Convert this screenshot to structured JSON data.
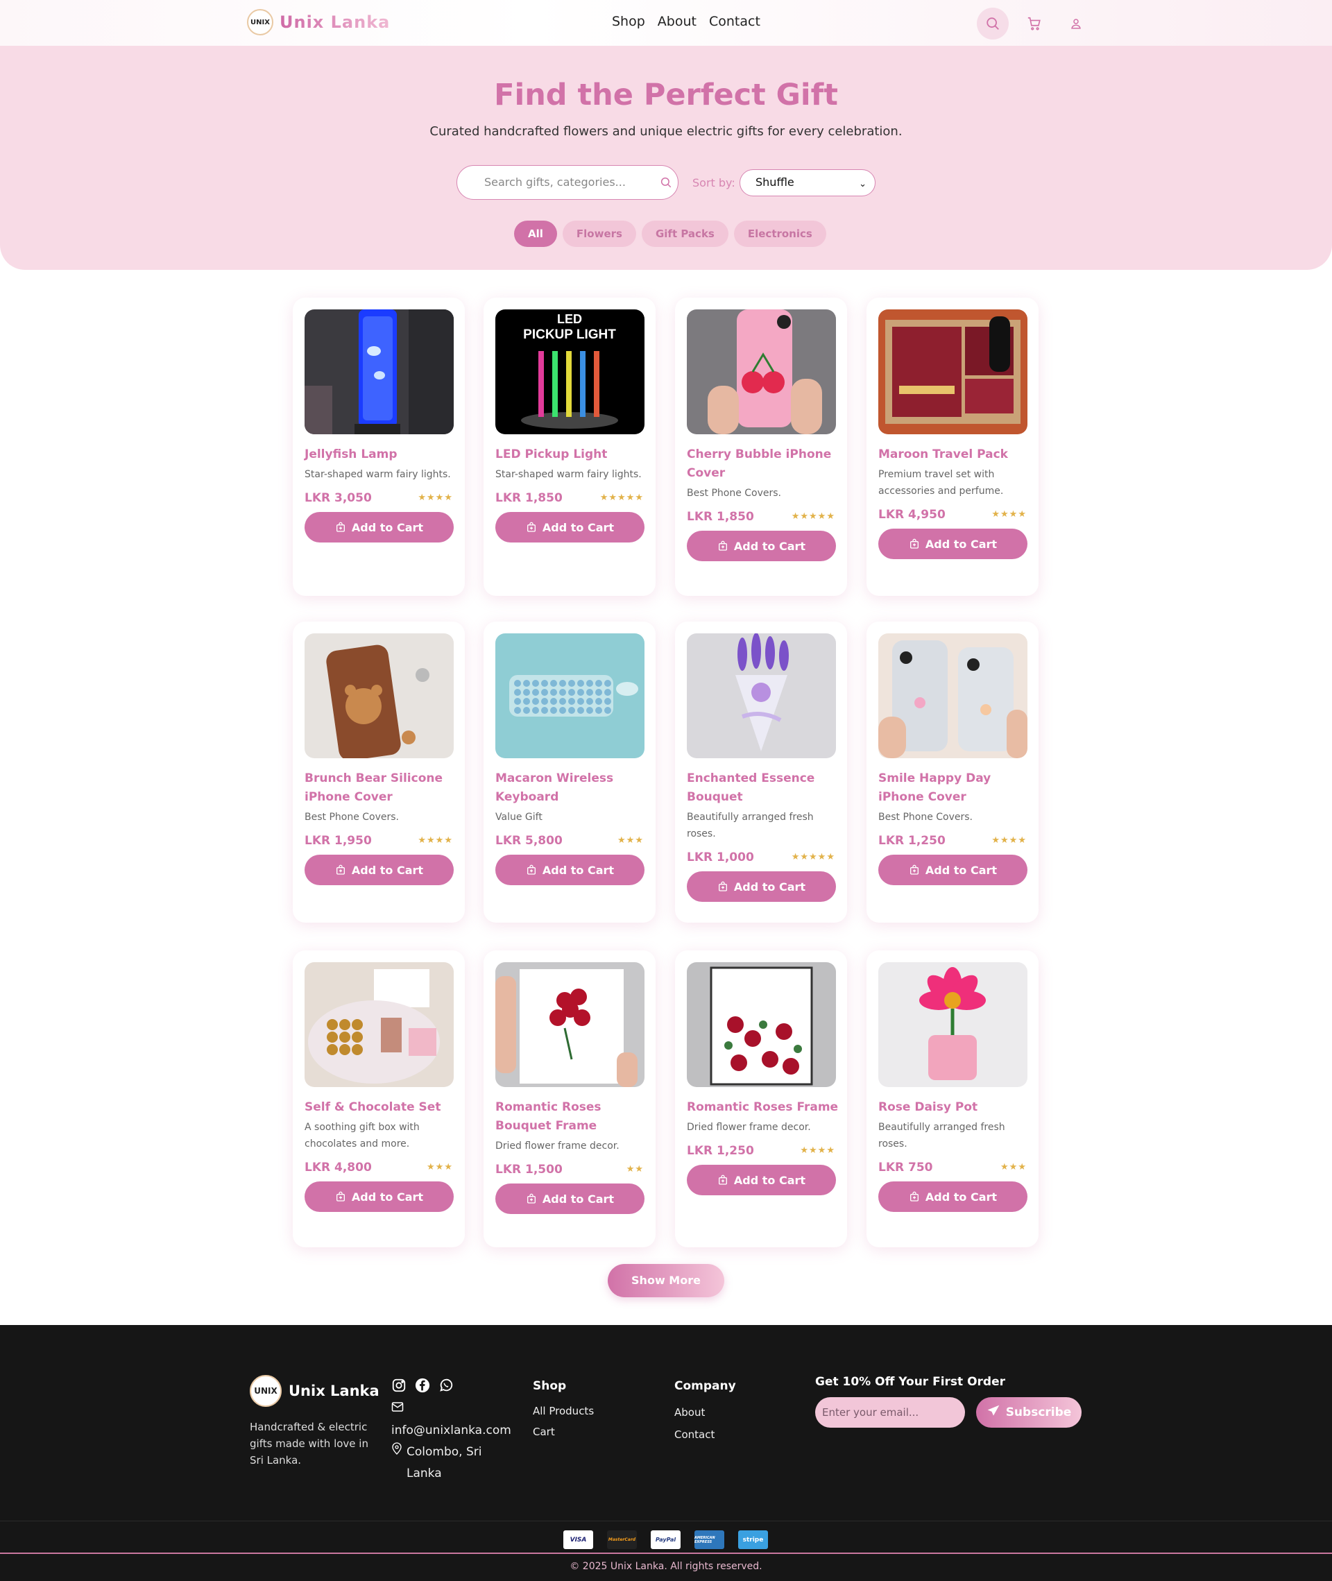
{
  "nav": {
    "logo_text": "UNIX",
    "brand": "Unix Lanka",
    "links": [
      "Shop",
      "About",
      "Contact"
    ],
    "icons": [
      "search-icon",
      "cart-icon",
      "user-icon"
    ]
  },
  "hero": {
    "title": "Find the Perfect Gift",
    "subtitle": "Curated handcrafted flowers and unique electric gifts for every celebration.",
    "search_placeholder": "Search gifts, categories...",
    "sort_label": "Sort by:",
    "sort_value": "Shuffle",
    "filters": [
      {
        "label": "All",
        "active": true
      },
      {
        "label": "Flowers",
        "active": false
      },
      {
        "label": "Gift Packs",
        "active": false
      },
      {
        "label": "Electronics",
        "active": false
      }
    ]
  },
  "products": [
    {
      "name": "Jellyfish Lamp",
      "desc": "Star-shaped warm fairy lights.",
      "price": "LKR 3,050",
      "stars": 4,
      "button": "Add to Cart"
    },
    {
      "name": "LED Pickup Light",
      "desc": "Star-shaped warm fairy lights.",
      "price": "LKR 1,850",
      "stars": 5,
      "button": "Add to Cart",
      "image_text": [
        "LED",
        "PICKUP LIGHT"
      ]
    },
    {
      "name": "Cherry Bubble iPhone Cover",
      "desc": "Best Phone Covers.",
      "price": "LKR 1,850",
      "stars": 5,
      "button": "Add to Cart"
    },
    {
      "name": "Maroon Travel Pack",
      "desc": "Premium travel set with accessories and perfume.",
      "price": "LKR 4,950",
      "stars": 4,
      "button": "Add to Cart"
    },
    {
      "name": "Brunch Bear Silicone iPhone Cover",
      "desc": "Best Phone Covers.",
      "price": "LKR 1,950",
      "stars": 4,
      "button": "Add to Cart"
    },
    {
      "name": "Macaron Wireless Keyboard",
      "desc": "Value Gift",
      "price": "LKR 5,800",
      "stars": 3,
      "button": "Add to Cart"
    },
    {
      "name": "Enchanted Essence Bouquet",
      "desc": "Beautifully arranged fresh roses.",
      "price": "LKR 1,000",
      "stars": 5,
      "button": "Add to Cart"
    },
    {
      "name": "Smile Happy Day iPhone Cover",
      "desc": "Best Phone Covers.",
      "price": "LKR 1,250",
      "stars": 4,
      "button": "Add to Cart"
    },
    {
      "name": "Self & Chocolate Set",
      "desc": "A soothing gift box with chocolates and more.",
      "price": "LKR 4,800",
      "stars": 3,
      "button": "Add to Cart"
    },
    {
      "name": "Romantic Roses Bouquet Frame",
      "desc": "Dried flower frame decor.",
      "price": "LKR 1,500",
      "stars": 2,
      "button": "Add to Cart"
    },
    {
      "name": "Romantic Roses Frame",
      "desc": "Dried flower frame decor.",
      "price": "LKR 1,250",
      "stars": 4,
      "button": "Add to Cart"
    },
    {
      "name": "Rose Daisy Pot",
      "desc": "Beautifully arranged fresh roses.",
      "price": "LKR 750",
      "stars": 3,
      "button": "Add to Cart"
    }
  ],
  "show_more": "Show More",
  "footer": {
    "brand": "Unix Lanka",
    "logo_text": "UNIX",
    "tagline": "Handcrafted & electric gifts made with love in Sri Lanka.",
    "social_icons": [
      "instagram-icon",
      "facebook-icon",
      "whatsapp-icon"
    ],
    "email": "info@unixlanka.com",
    "location": "Colombo, Sri Lanka",
    "shop_title": "Shop",
    "shop_links": [
      "All Products",
      "Cart"
    ],
    "company_title": "Company",
    "company_links": [
      "About",
      "Contact"
    ],
    "newsletter_title": "Get 10% Off Your First Order",
    "email_placeholder": "Enter your email...",
    "subscribe": "Subscribe",
    "payments": [
      "VISA",
      "MasterCard",
      "PayPal",
      "AMERICAN EXPRESS",
      "stripe"
    ],
    "copyright": "© 2025 Unix Lanka. All rights reserved."
  },
  "colors": {
    "accent": "#d172a8",
    "hero_bg": "#f8dbe6",
    "star": "#e2b24a",
    "footer_bg": "#161616"
  }
}
